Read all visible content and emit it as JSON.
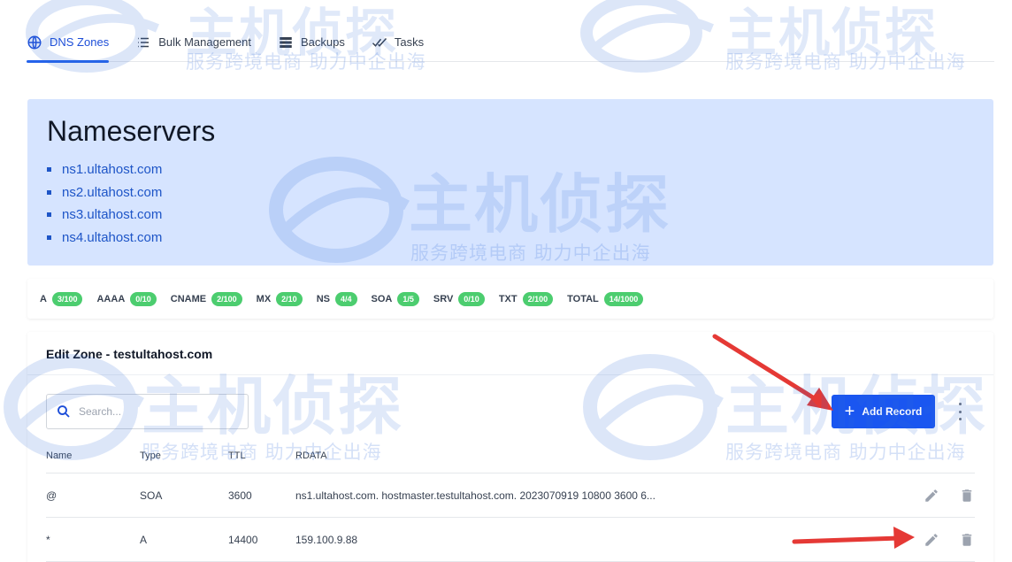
{
  "tabs": [
    {
      "label": "DNS Zones",
      "icon": "globe-icon",
      "active": true
    },
    {
      "label": "Bulk Management",
      "icon": "list-icon",
      "active": false
    },
    {
      "label": "Backups",
      "icon": "server-icon",
      "active": false
    },
    {
      "label": "Tasks",
      "icon": "double-check-icon",
      "active": false
    }
  ],
  "nameservers": {
    "title": "Nameservers",
    "items": [
      "ns1.ultahost.com",
      "ns2.ultahost.com",
      "ns3.ultahost.com",
      "ns4.ultahost.com"
    ]
  },
  "counts": [
    {
      "type": "A",
      "badge": "3/100"
    },
    {
      "type": "AAAA",
      "badge": "0/10"
    },
    {
      "type": "CNAME",
      "badge": "2/100"
    },
    {
      "type": "MX",
      "badge": "2/10"
    },
    {
      "type": "NS",
      "badge": "4/4"
    },
    {
      "type": "SOA",
      "badge": "1/5"
    },
    {
      "type": "SRV",
      "badge": "0/10"
    },
    {
      "type": "TXT",
      "badge": "2/100"
    },
    {
      "type": "TOTAL",
      "badge": "14/1000"
    }
  ],
  "zone": {
    "title": "Edit Zone - testultahost.com",
    "search_placeholder": "Search...",
    "add_label": "Add Record",
    "columns": {
      "name": "Name",
      "type": "Type",
      "ttl": "TTL",
      "rdata": "RDATA"
    },
    "rows": [
      {
        "name": "@",
        "type": "SOA",
        "ttl": "3600",
        "rdata": "ns1.ultahost.com. hostmaster.testultahost.com. 2023070919 10800 3600 6..."
      },
      {
        "name": "*",
        "type": "A",
        "ttl": "14400",
        "rdata": "159.100.9.88"
      }
    ]
  },
  "watermark": {
    "brand": "主机侦探",
    "slogan": "服务跨境电商 助力中企出海"
  },
  "colors": {
    "accent": "#1a56f0",
    "badge": "#4ccd6f",
    "ns_panel": "#d6e4ff",
    "arrow": "#e53935"
  }
}
